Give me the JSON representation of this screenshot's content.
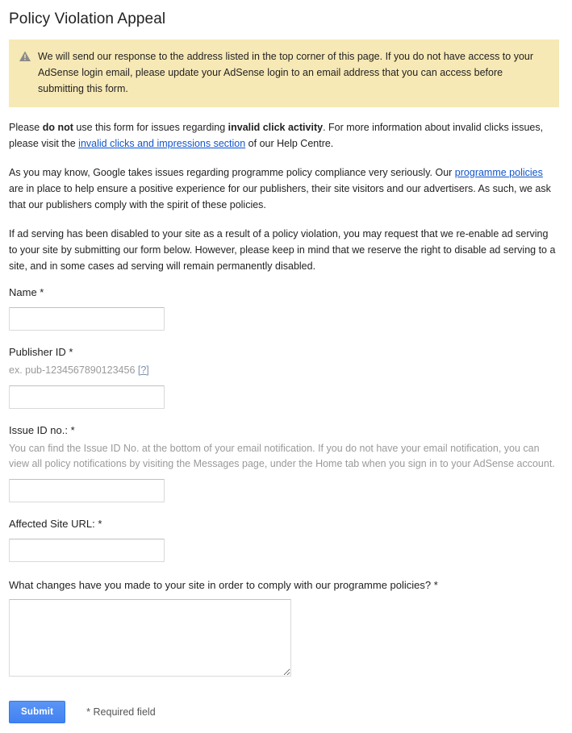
{
  "page": {
    "title": "Policy Violation Appeal"
  },
  "warning": {
    "icon": "warning-triangle-icon",
    "text": "We will send our response to the address listed in the top corner of this page. If you do not have access to your AdSense login email, please update your AdSense login to an email address that you can access before submitting this form.",
    "background_color": "#f7e9b5"
  },
  "intro": {
    "p1_a": "Please ",
    "p1_b": "do not",
    "p1_c": " use this form for issues regarding ",
    "p1_d": "invalid click activity",
    "p1_e": ". For more information about invalid clicks issues, please visit the ",
    "p1_link": "invalid clicks and impressions section",
    "p1_f": " of our Help Centre.",
    "p2_a": "As you may know, Google takes issues regarding programme policy compliance very seriously. Our ",
    "p2_link": "programme policies",
    "p2_b": " are in place to help ensure a positive experience for our publishers, their site visitors and our advertisers. As such, we ask that our publishers comply with the spirit of these policies.",
    "p3": "If ad serving has been disabled to your site as a result of a policy violation, you may request that we re-enable ad serving to your site by submitting our form below. However, please keep in mind that we reserve the right to disable ad serving to a site, and in some cases ad serving will remain permanently disabled."
  },
  "form": {
    "name": {
      "label": "Name *",
      "value": "",
      "placeholder": ""
    },
    "publisher_id": {
      "label": "Publisher ID *",
      "hint_prefix": "ex. pub-1234567890123456 ",
      "hint_link": "[?]",
      "value": "",
      "placeholder": ""
    },
    "issue_id": {
      "label": "Issue ID no.: *",
      "hint": "You can find the Issue ID No. at the bottom of your email notification. If you do not have your email notification, you can view all policy notifications by visiting the Messages page, under the Home tab when you sign in to your AdSense account.",
      "value": "",
      "placeholder": ""
    },
    "affected_site_url": {
      "label": "Affected Site URL: *",
      "value": "",
      "placeholder": ""
    },
    "changes": {
      "label": "What changes have you made to your site in order to comply with our programme policies? *",
      "value": "",
      "placeholder": ""
    }
  },
  "footer": {
    "submit_label": "Submit",
    "required_note": "* Required field",
    "submit_color": "#4d8ef4"
  }
}
